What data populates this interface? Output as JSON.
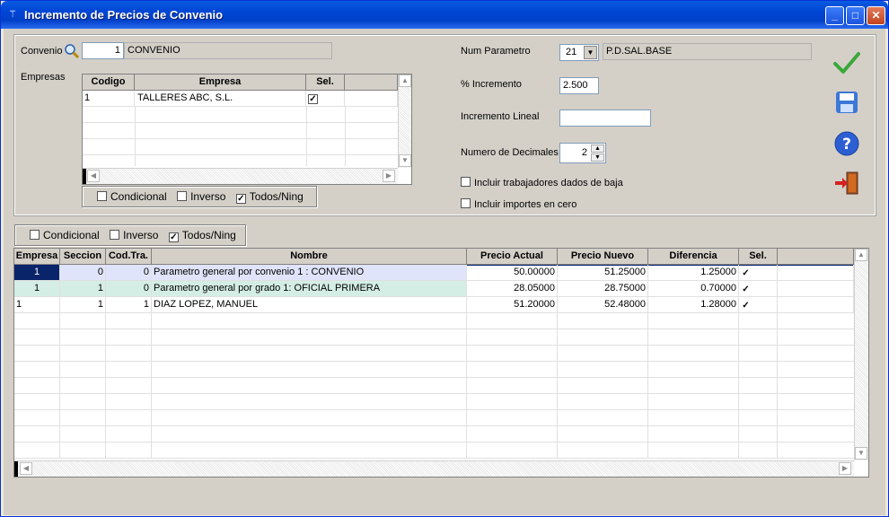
{
  "window": {
    "title": "Incremento de Precios de Convenio",
    "icon": "app-icon",
    "min": "_",
    "max": "□",
    "close": "✕"
  },
  "convenio": {
    "label": "Convenio",
    "code": "1",
    "name": "CONVENIO"
  },
  "empresas": {
    "label": "Empresas",
    "headers": [
      "Codigo",
      "Empresa",
      "Sel."
    ],
    "rows": [
      {
        "codigo": "1",
        "empresa": "TALLERES ABC, S.L.",
        "sel": "✓"
      }
    ]
  },
  "opts_top": {
    "condicional": "Condicional",
    "inverso": "Inverso",
    "todos": "Todos/Ning",
    "todos_checked": "✓"
  },
  "params": {
    "num_parametro_label": "Num Parametro",
    "num_parametro_value": "21",
    "num_parametro_desc": "P.D.SAL.BASE",
    "incremento_label": "% Incremento",
    "incremento_value": "2.500",
    "lineal_label": "Incremento Lineal",
    "lineal_value": "",
    "decimales_label": "Numero de Decimales",
    "decimales_value": "2",
    "baja_label": "Incluir trabajadores dados de baja",
    "cero_label": "Incluir importes en cero"
  },
  "opts_bottom": {
    "condicional": "Condicional",
    "inverso": "Inverso",
    "todos": "Todos/Ning",
    "todos_checked": "✓"
  },
  "main_grid": {
    "headers": [
      "Empresa",
      "Seccion",
      "Cod.Tra.",
      "Nombre",
      "Precio Actual",
      "Precio Nuevo",
      "Diferencia",
      "Sel."
    ],
    "rows": [
      {
        "empresa": "1",
        "seccion": "0",
        "codtra": "0",
        "nombre": "Parametro general por convenio 1 : CONVENIO",
        "actual": "50.00000",
        "nuevo": "51.25000",
        "dif": "1.25000",
        "sel": "✓"
      },
      {
        "empresa": "1",
        "seccion": "1",
        "codtra": "0",
        "nombre": "Parametro general por grado  1: OFICIAL PRIMERA",
        "actual": "28.05000",
        "nuevo": "28.75000",
        "dif": "0.70000",
        "sel": "✓"
      },
      {
        "empresa": "1",
        "seccion": "1",
        "codtra": "1",
        "nombre": "DIAZ  LOPEZ, MANUEL",
        "actual": "51.20000",
        "nuevo": "52.48000",
        "dif": "1.28000",
        "sel": "✓"
      }
    ]
  },
  "colors": {
    "row1_bg": "#e0e4fa",
    "row2_bg": "#d4eee6",
    "accent": "#0a246a"
  }
}
